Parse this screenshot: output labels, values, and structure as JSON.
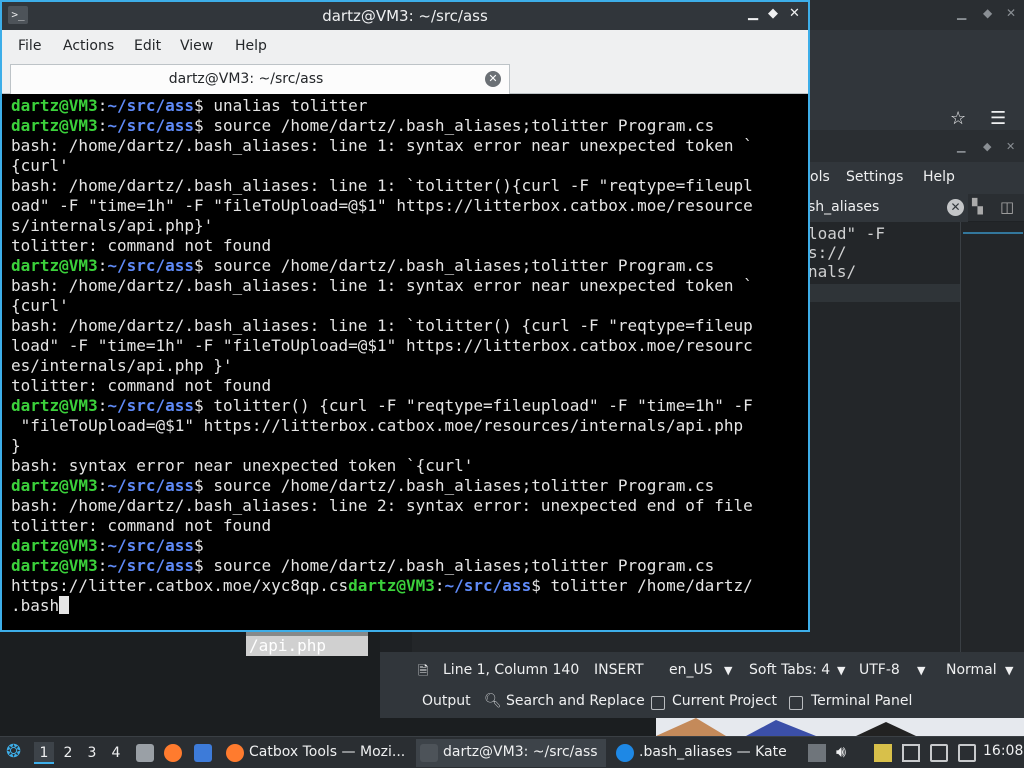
{
  "terminal": {
    "window_title": "dartz@VM3: ~/src/ass",
    "menu": [
      "File",
      "Actions",
      "Edit",
      "View",
      "Help"
    ],
    "tab_label": "dartz@VM3: ~/src/ass",
    "lines": [
      {
        "prompt": true,
        "user": "dartz@VM3",
        "path": "~/src/ass",
        "text": " unalias tolitter"
      },
      {
        "prompt": true,
        "user": "dartz@VM3",
        "path": "~/src/ass",
        "text": " source /home/dartz/.bash_aliases;tolitter Program.cs"
      },
      {
        "prompt": false,
        "text": "bash: /home/dartz/.bash_aliases: line 1: syntax error near unexpected token `"
      },
      {
        "prompt": false,
        "text": "{curl'"
      },
      {
        "prompt": false,
        "text": "bash: /home/dartz/.bash_aliases: line 1: `tolitter(){curl -F \"reqtype=fileupl"
      },
      {
        "prompt": false,
        "text": "oad\" -F \"time=1h\" -F \"fileToUpload=@$1\" https://litterbox.catbox.moe/resource"
      },
      {
        "prompt": false,
        "text": "s/internals/api.php}'"
      },
      {
        "prompt": false,
        "text": "tolitter: command not found"
      },
      {
        "prompt": true,
        "user": "dartz@VM3",
        "path": "~/src/ass",
        "text": " source /home/dartz/.bash_aliases;tolitter Program.cs"
      },
      {
        "prompt": false,
        "text": "bash: /home/dartz/.bash_aliases: line 1: syntax error near unexpected token `"
      },
      {
        "prompt": false,
        "text": "{curl'"
      },
      {
        "prompt": false,
        "text": "bash: /home/dartz/.bash_aliases: line 1: `tolitter() {curl -F \"reqtype=fileup"
      },
      {
        "prompt": false,
        "text": "load\" -F \"time=1h\" -F \"fileToUpload=@$1\" https://litterbox.catbox.moe/resourc"
      },
      {
        "prompt": false,
        "text": "es/internals/api.php }'"
      },
      {
        "prompt": false,
        "text": "tolitter: command not found"
      },
      {
        "prompt": true,
        "user": "dartz@VM3",
        "path": "~/src/ass",
        "text": " tolitter() {curl -F \"reqtype=fileupload\" -F \"time=1h\" -F"
      },
      {
        "prompt": false,
        "text": " \"fileToUpload=@$1\" https://litterbox.catbox.moe/resources/internals/api.php"
      },
      {
        "prompt": false,
        "text": "}"
      },
      {
        "prompt": false,
        "text": "bash: syntax error near unexpected token `{curl'"
      },
      {
        "prompt": true,
        "user": "dartz@VM3",
        "path": "~/src/ass",
        "text": " source /home/dartz/.bash_aliases;tolitter Program.cs"
      },
      {
        "prompt": false,
        "text": "bash: /home/dartz/.bash_aliases: line 2: syntax error: unexpected end of file"
      },
      {
        "prompt": false,
        "text": "tolitter: command not found"
      },
      {
        "prompt": true,
        "user": "dartz@VM3",
        "path": "~/src/ass",
        "text": ""
      },
      {
        "prompt": true,
        "user": "dartz@VM3",
        "path": "~/src/ass",
        "text": " source /home/dartz/.bash_aliases;tolitter Program.cs"
      },
      {
        "prompt": "mid",
        "pre": "https://litter.catbox.moe/xyc8qp.cs",
        "user": "dartz@VM3",
        "path": "~/src/ass",
        "text": " tolitter /home/dartz/"
      },
      {
        "prompt": false,
        "text": ".bash",
        "cursor": true
      }
    ]
  },
  "behind_text": [
    "/api.php"
  ],
  "kate": {
    "menu": [
      "ols",
      "Settings",
      "Help"
    ],
    "doc_tab": "sh_aliases",
    "code_lines": [
      "load\" -F",
      "s://",
      "nals/"
    ],
    "status": {
      "position": "Line 1, Column 140",
      "mode": "INSERT",
      "language": "en_US",
      "indent": "Soft Tabs: 4",
      "encoding": "UTF-8",
      "input_mode": "Normal"
    },
    "toolviews": [
      "Output",
      "Search and Replace",
      "Current Project",
      "Terminal Panel"
    ]
  },
  "taskbar": {
    "desktops": [
      "1",
      "2",
      "3",
      "4"
    ],
    "tasks": [
      "Catbox Tools — Mozi...",
      "dartz@VM3: ~/src/ass",
      ".bash_aliases — Kate"
    ],
    "clock": "16:08"
  },
  "colors": {
    "prompt_user": "#3bd13b",
    "prompt_path": "#5f8af7",
    "accent": "#3daee9",
    "terminal_bg": "#000000"
  }
}
